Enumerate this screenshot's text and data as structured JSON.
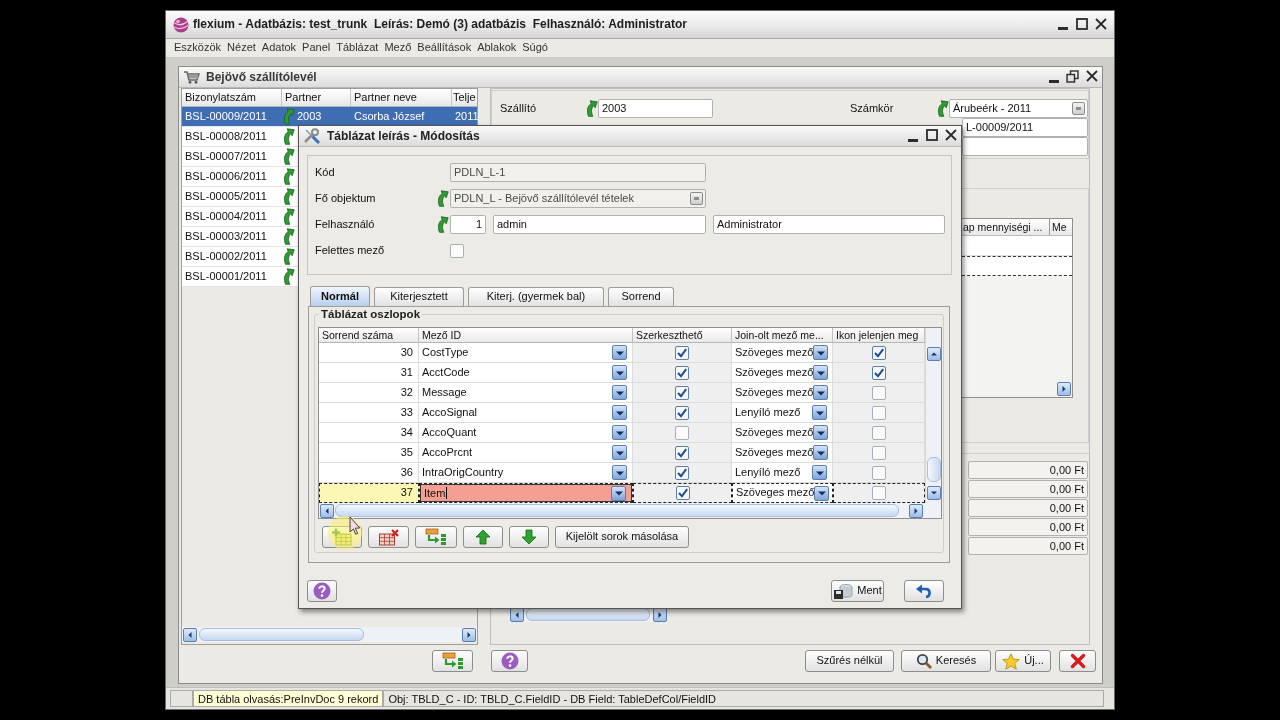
{
  "app": {
    "title": "flexium - Adatbázis: test_trunk  Leírás: Demó (3) adatbázis  Felhasználó: Administrator",
    "menu": [
      "Eszközök",
      "Nézet",
      "Adatok",
      "Panel",
      "Táblázat",
      "Mező",
      "Beállítások",
      "Ablakok",
      "Súgó"
    ]
  },
  "document_window": {
    "title": "Bejövő szállítólevél",
    "list": {
      "columns": [
        "Bizonylatszám",
        "Partner",
        "Partner neve",
        "Telje"
      ],
      "rows": [
        {
          "number": "BSL-00009/2011",
          "partner": "2003",
          "partner_name": "Csorba József",
          "column_4": "2011",
          "selected": true
        },
        {
          "number": "BSL-00008/2011",
          "selected": false
        },
        {
          "number": "BSL-00007/2011",
          "selected": false
        },
        {
          "number": "BSL-00006/2011",
          "selected": false
        },
        {
          "number": "BSL-00005/2011",
          "selected": false
        },
        {
          "number": "BSL-00004/2011",
          "selected": false
        },
        {
          "number": "BSL-00003/2011",
          "selected": false
        },
        {
          "number": "BSL-00002/2011",
          "selected": false
        },
        {
          "number": "BSL-00001/2011",
          "selected": false
        }
      ]
    },
    "supplier": {
      "label": "Szállító",
      "value": "2003"
    },
    "number_range": {
      "label": "Számkör",
      "value": "Árubeérk - 2011"
    },
    "document_number": {
      "value": "L-00009/2011"
    },
    "grid": {
      "columns": [
        "ap mennyiségi ...",
        "Me"
      ]
    },
    "totals": [
      "0,00 Ft",
      "0,00 Ft",
      "0,00 Ft",
      "0,00 Ft",
      "0,00 Ft"
    ],
    "buttons": [
      "Szűrés nélkül",
      "Keresés",
      "Új..."
    ]
  },
  "dialog": {
    "title": "Táblázat leírás - Módosítás",
    "code": {
      "label": "Kód",
      "value": "PDLN_L-1",
      "read_only": true
    },
    "main_object": {
      "label": "Fő objektum",
      "value": "PDLN_L - Bejövő szállítólevél tételek",
      "read_only": true
    },
    "user": {
      "label": "Felhasználó",
      "id": "1",
      "login": "admin",
      "name": "Administrator"
    },
    "parent_field": {
      "label": "Felettes mező",
      "checked": false
    },
    "tabs": [
      {
        "label": "Normál",
        "selected": true
      },
      {
        "label": "Kiterjesztett",
        "selected": false
      },
      {
        "label": "Kiterj. (gyermek bal)",
        "selected": false
      },
      {
        "label": "Sorrend",
        "selected": false
      }
    ],
    "group_title": "Táblázat oszlopok",
    "table": {
      "columns": [
        "Sorrend száma",
        "Mező ID",
        "Szerkeszthető",
        "Join-olt mező me...",
        "Ikon jelenjen meg"
      ],
      "rows": [
        {
          "order": "30",
          "field_id": "CostType",
          "editable": true,
          "join_type": "Szöveges mező",
          "show_icon": true,
          "selected": false,
          "editing": false
        },
        {
          "order": "31",
          "field_id": "AcctCode",
          "editable": true,
          "join_type": "Szöveges mező",
          "show_icon": true,
          "selected": false,
          "editing": false
        },
        {
          "order": "32",
          "field_id": "Message",
          "editable": true,
          "join_type": "Szöveges mező",
          "show_icon": false,
          "selected": false,
          "editing": false
        },
        {
          "order": "33",
          "field_id": "AccoSignal",
          "editable": true,
          "join_type": "Lenyíló mező",
          "show_icon": false,
          "selected": false,
          "editing": false
        },
        {
          "order": "34",
          "field_id": "AccoQuant",
          "editable": false,
          "join_type": "Szöveges mező",
          "show_icon": false,
          "selected": false,
          "editing": false
        },
        {
          "order": "35",
          "field_id": "AccoPrcnt",
          "editable": true,
          "join_type": "Szöveges mező",
          "show_icon": false,
          "selected": false,
          "editing": false
        },
        {
          "order": "36",
          "field_id": "IntraOrigCountry",
          "editable": true,
          "join_type": "Lenyíló mező",
          "show_icon": false,
          "selected": false,
          "editing": false
        },
        {
          "order": "37",
          "field_id": "Item",
          "editable": true,
          "join_type": "Szöveges mező",
          "show_icon": false,
          "selected": true,
          "editing": true
        }
      ]
    },
    "copy_button": "Kijelölt sorok másolása",
    "save_button": "Ment"
  },
  "status_bar": {
    "message": "DB tábla olvasás:PreInvDoc 9 rekord",
    "info": "Obj: TBLD_C - ID: TBLD_C.FieldID - DB Field: TableDefCol/FieldID"
  }
}
